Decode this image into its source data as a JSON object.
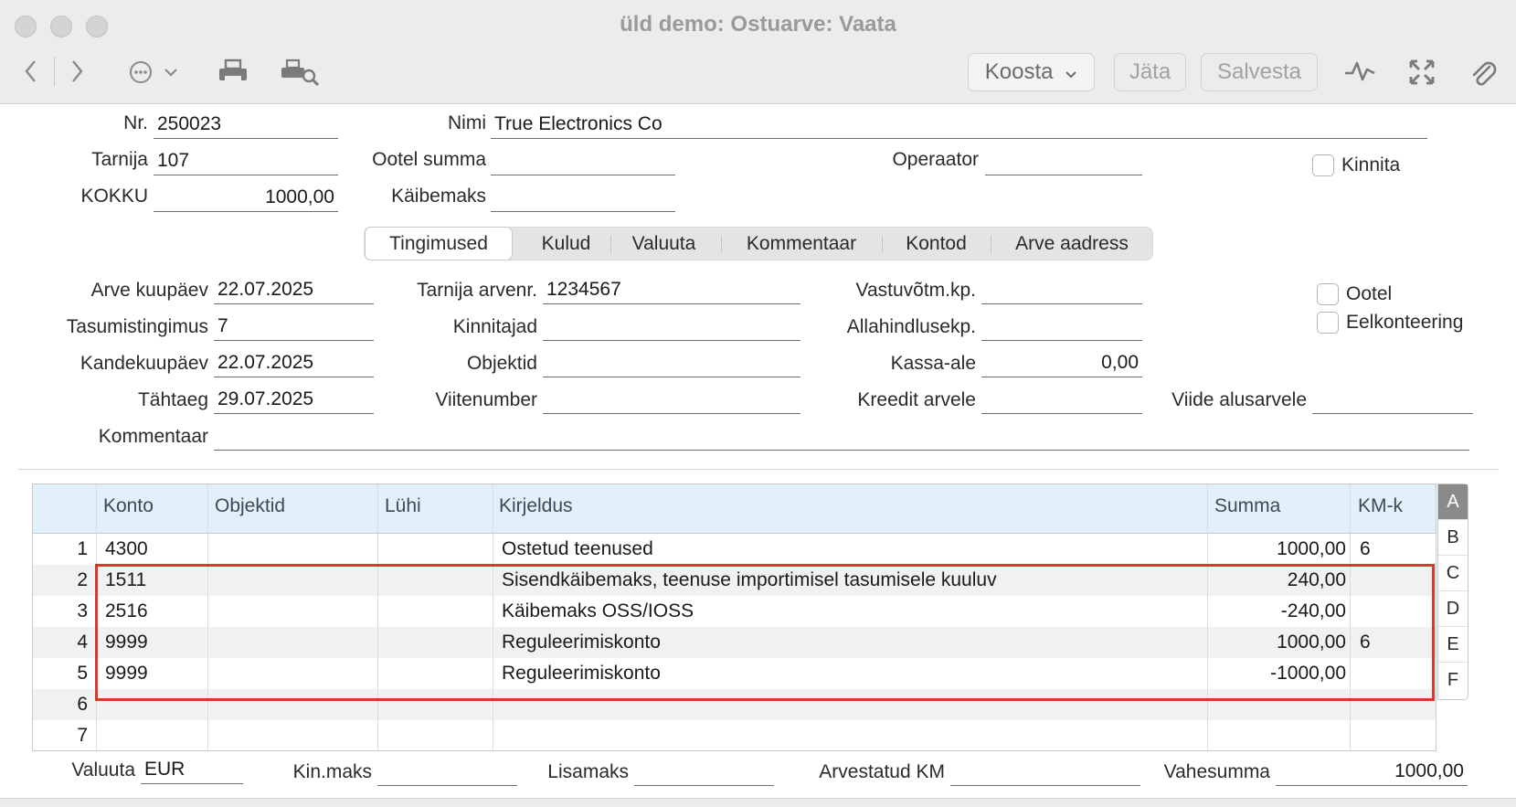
{
  "window": {
    "title": "üld demo: Ostuarve: Vaata"
  },
  "toolbar": {
    "icons": [
      "back-icon",
      "forward-icon",
      "more-options-icon",
      "print-icon",
      "print-preview-icon",
      "activity-icon",
      "fullscreen-icon",
      "attachment-icon"
    ],
    "create_label": "Koosta",
    "leave_label": "Jäta",
    "save_label": "Salvesta"
  },
  "header": {
    "nr_label": "Nr.",
    "nr_value": "250023",
    "name_label": "Nimi",
    "name_value": "True Electronics Co",
    "supplier_label": "Tarnija",
    "supplier_value": "107",
    "pending_sum_label": "Ootel summa",
    "pending_sum_value": "",
    "operator_label": "Operaator",
    "operator_value": "",
    "confirm_label": "Kinnita",
    "total_label": "KOKKU",
    "total_value": "1000,00",
    "vat_label": "Käibemaks",
    "vat_value": ""
  },
  "tabs": [
    "Tingimused",
    "Kulud",
    "Valuuta",
    "Kommentaar",
    "Kontod",
    "Arve aadress"
  ],
  "terms": {
    "invoice_date_label": "Arve kuupäev",
    "invoice_date": "22.07.2025",
    "supplier_invoice_no_label": "Tarnija arvenr.",
    "supplier_invoice_no": "1234567",
    "receipt_date_label": "Vastuvõtm.kp.",
    "receipt_date": "",
    "pending_label": "Ootel",
    "payment_terms_label": "Tasumistingimus",
    "payment_terms": "7",
    "approvers_label": "Kinnitajad",
    "approvers": "",
    "discount_date_label": "Allahindlusekp.",
    "discount_date": "",
    "preposting_label": "Eelkonteering",
    "transaction_date_label": "Kandekuupäev",
    "transaction_date": "22.07.2025",
    "objects_label": "Objektid",
    "objects": "",
    "cash_discount_label": "Kassa-ale",
    "cash_discount": "0,00",
    "due_date_label": "Tähtaeg",
    "due_date": "29.07.2025",
    "reference_no_label": "Viitenumber",
    "reference_no": "",
    "credit_invoice_label": "Kreedit arvele",
    "credit_invoice": "",
    "base_invoice_ref_label": "Viide alusarvele",
    "base_invoice_ref": "",
    "comment_label": "Kommentaar",
    "comment": ""
  },
  "grid": {
    "columns": [
      "",
      "Konto",
      "Objektid",
      "Lühi",
      "Kirjeldus",
      "Summa",
      "KM-k"
    ],
    "rows": [
      {
        "no": "1",
        "account": "4300",
        "objects": "",
        "short": "",
        "description": "Ostetud teenused",
        "amount": "1000,00",
        "vat_code": "6"
      },
      {
        "no": "2",
        "account": "1511",
        "objects": "",
        "short": "",
        "description": "Sisendkäibemaks, teenuse importimisel tasumisele kuuluv",
        "amount": "240,00",
        "vat_code": ""
      },
      {
        "no": "3",
        "account": "2516",
        "objects": "",
        "short": "",
        "description": "Käibemaks OSS/IOSS",
        "amount": "-240,00",
        "vat_code": ""
      },
      {
        "no": "4",
        "account": "9999",
        "objects": "",
        "short": "",
        "description": "Reguleerimiskonto",
        "amount": "1000,00",
        "vat_code": "6"
      },
      {
        "no": "5",
        "account": "9999",
        "objects": "",
        "short": "",
        "description": "Reguleerimiskonto",
        "amount": "-1000,00",
        "vat_code": ""
      },
      {
        "no": "6",
        "account": "",
        "objects": "",
        "short": "",
        "description": "",
        "amount": "",
        "vat_code": ""
      },
      {
        "no": "7",
        "account": "",
        "objects": "",
        "short": "",
        "description": "",
        "amount": "",
        "vat_code": ""
      }
    ],
    "side_letters": [
      "A",
      "B",
      "C",
      "D",
      "E",
      "F"
    ],
    "highlight_color": "#d9382c"
  },
  "footer": {
    "currency_label": "Valuuta",
    "currency": "EUR",
    "kin_tax_label": "Kin.maks",
    "kin_tax": "",
    "extra_tax_label": "Lisamaks",
    "extra_tax": "",
    "calc_vat_label": "Arvestatud KM",
    "calc_vat": "",
    "subtotal_label": "Vahesumma",
    "subtotal": "1000,00"
  }
}
